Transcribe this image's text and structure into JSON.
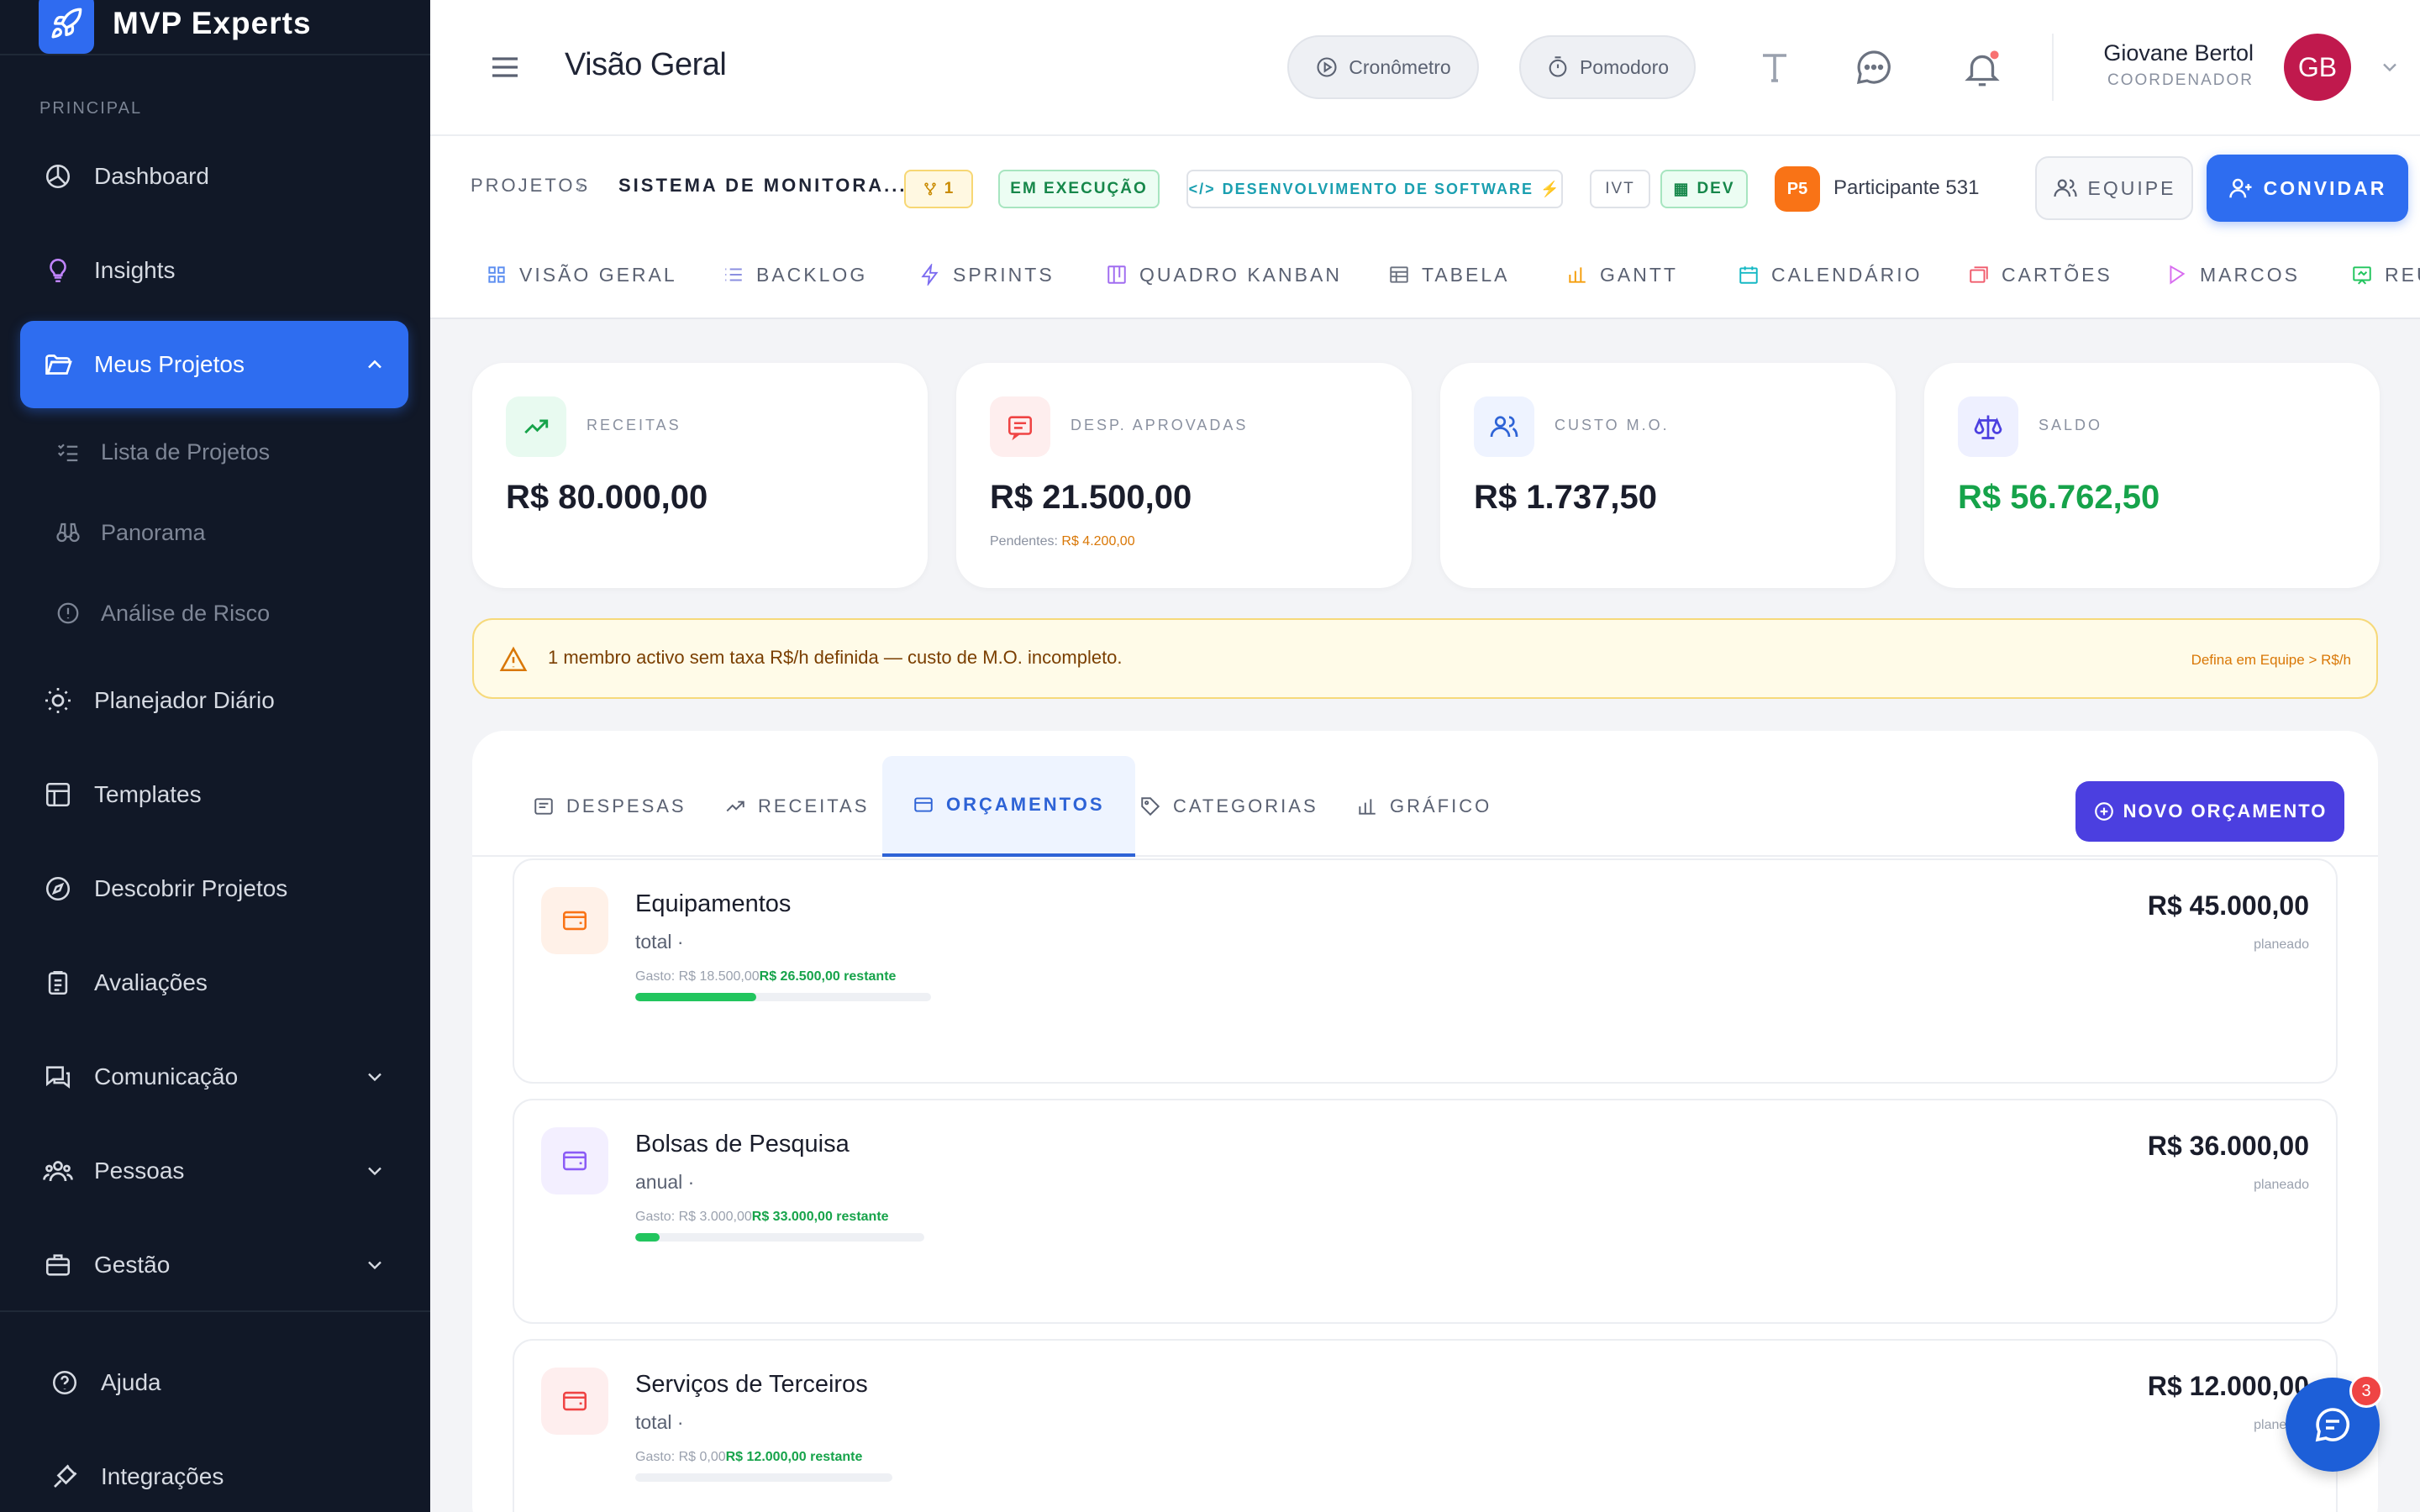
{
  "app": {
    "name": "MVP Experts",
    "accent": "#2e6df0"
  },
  "sidebar": {
    "section": "PRINCIPAL",
    "items": [
      {
        "label": "Dashboard",
        "icon": "dashboard-icon"
      },
      {
        "label": "Insights",
        "icon": "lightbulb-icon"
      },
      {
        "label": "Meus Projetos",
        "icon": "folder-icon",
        "active": true
      },
      {
        "label": "Planejador Diário",
        "icon": "sun-icon"
      },
      {
        "label": "Templates",
        "icon": "template-icon"
      },
      {
        "label": "Descobrir Projetos",
        "icon": "compass-icon"
      },
      {
        "label": "Avaliações",
        "icon": "clipboard-icon"
      },
      {
        "label": "Comunicação",
        "icon": "chat-icon"
      },
      {
        "label": "Pessoas",
        "icon": "people-icon"
      },
      {
        "label": "Gestão",
        "icon": "briefcase-icon"
      }
    ],
    "subitems": [
      {
        "label": "Lista de Projetos",
        "icon": "list-check-icon"
      },
      {
        "label": "Panorama",
        "icon": "binoculars-icon"
      },
      {
        "label": "Análise de Risco",
        "icon": "alert-circle-icon"
      }
    ],
    "footer": [
      {
        "label": "Ajuda",
        "icon": "help-icon"
      },
      {
        "label": "Integrações",
        "icon": "plug-icon"
      }
    ]
  },
  "header": {
    "title": "Visão Geral",
    "timer_label": "Cronômetro",
    "pomodoro_label": "Pomodoro",
    "user": {
      "name": "Giovane Bertol",
      "role": "COORDENADOR",
      "initials": "GB"
    }
  },
  "project": {
    "crumb_root": "PROJETOS",
    "crumb_name": "SISTEMA DE MONITORA...",
    "branch_count": "1",
    "status": "EM EXECUÇÃO",
    "type": "DESENVOLVIMENTO DE SOFTWARE",
    "tag1": "IVT",
    "tag2": "DEV",
    "participant_initials": "P5",
    "participant": "Participante 531",
    "team_label": "EQUIPE",
    "invite_label": "CONVIDAR"
  },
  "tabs": [
    "VISÃO GERAL",
    "BACKLOG",
    "SPRINTS",
    "QUADRO KANBAN",
    "TABELA",
    "GANTT",
    "CALENDÁRIO",
    "CARTÕES",
    "MARCOS",
    "REU"
  ],
  "summary": [
    {
      "label": "RECEITAS",
      "value": "R$ 80.000,00",
      "color": "#1a1d2b"
    },
    {
      "label": "DESP. APROVADAS",
      "value": "R$ 21.500,00",
      "pending_label": "Pendentes:",
      "pending_value": "R$ 4.200,00",
      "color": "#1a1d2b"
    },
    {
      "label": "CUSTO M.O.",
      "value": "R$ 1.737,50",
      "color": "#1a1d2b"
    },
    {
      "label": "SALDO",
      "value": "R$ 56.762,50",
      "color": "#16a34a"
    }
  ],
  "warning": {
    "text": "1 membro activo sem taxa R$/h definida — custo de M.O. incompleto.",
    "link": "Defina em Equipe > R$/h"
  },
  "finance_tabs": [
    "DESPESAS",
    "RECEITAS",
    "ORÇAMENTOS",
    "CATEGORIAS",
    "GRÁFICO"
  ],
  "new_budget_label": "NOVO ORÇAMENTO",
  "budgets": [
    {
      "name": "Equipamentos",
      "period": "total ·",
      "spent": "Gasto: R$ 18.500,00",
      "remaining": "R$ 26.500,00 restante",
      "amount": "R$ 45.000,00",
      "planned": "planeado",
      "progress": 0.41,
      "color": "#f97316",
      "bg": "#fff1e8"
    },
    {
      "name": "Bolsas de Pesquisa",
      "period": "anual ·",
      "spent": "Gasto: R$ 3.000,00",
      "remaining": "R$ 33.000,00 restante",
      "amount": "R$ 36.000,00",
      "planned": "planeado",
      "progress": 0.083,
      "color": "#8b5cf6",
      "bg": "#f3efff"
    },
    {
      "name": "Serviços de Terceiros",
      "period": "total ·",
      "spent": "Gasto: R$ 0,00",
      "remaining": "R$ 12.000,00 restante",
      "amount": "R$ 12.000,00",
      "planned": "planeado",
      "progress": 0,
      "color": "#ef4444",
      "bg": "#feeeee"
    }
  ],
  "chat": {
    "count": "3"
  }
}
